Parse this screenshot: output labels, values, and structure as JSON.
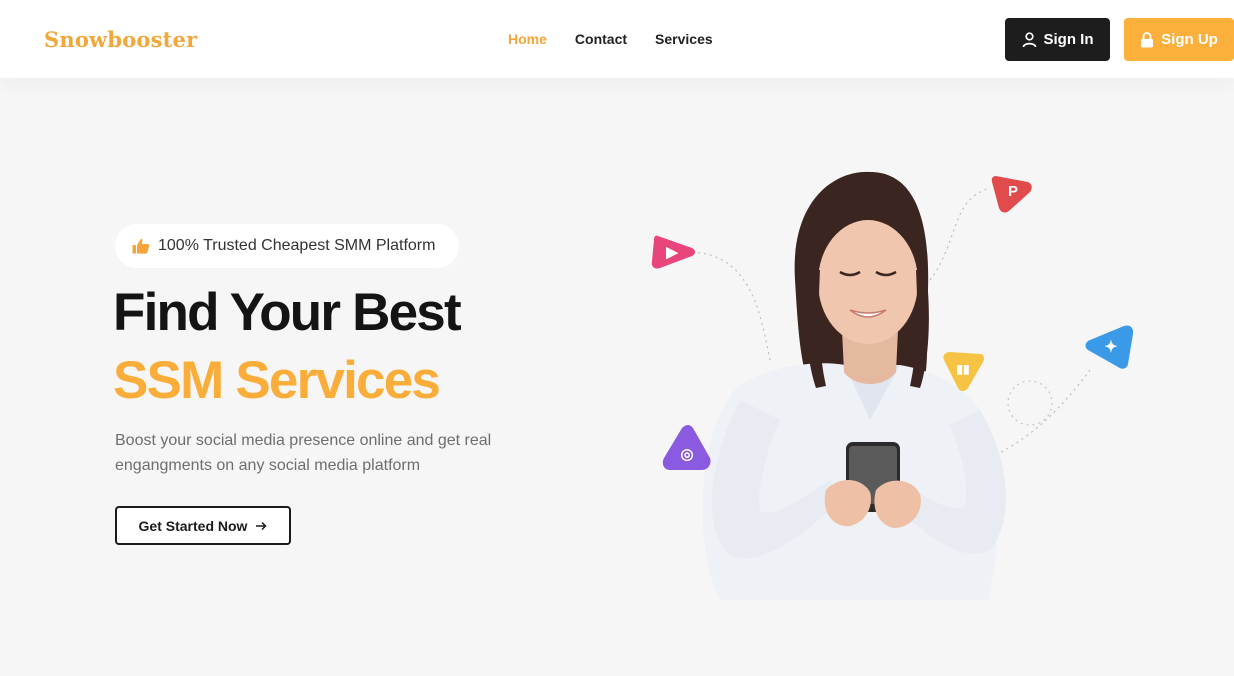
{
  "header": {
    "logo": "Snowbooster",
    "nav": [
      {
        "label": "Home",
        "active": true
      },
      {
        "label": "Contact",
        "active": false
      },
      {
        "label": "Services",
        "active": false
      }
    ],
    "signin_label": "Sign In",
    "signup_label": "Sign Up"
  },
  "hero": {
    "badge": "100% Trusted Cheapest SMM Platform",
    "title_line1": "Find Your Best",
    "title_line2": "SSM Services",
    "description": "Boost your social media presence online and get real engangments on any social media platform",
    "cta_label": "Get Started Now"
  },
  "illustration": {
    "icons": [
      "youtube-icon",
      "pinterest-icon",
      "analytics-icon",
      "twitter-icon",
      "instagram-icon"
    ]
  },
  "colors": {
    "accent": "#fbad3a",
    "dark": "#1d1d1d",
    "youtube": "#e8457a",
    "pinterest": "#e14b4b",
    "analytics": "#f6c344",
    "twitter": "#3b9ae8",
    "instagram": "#8a5be0"
  }
}
